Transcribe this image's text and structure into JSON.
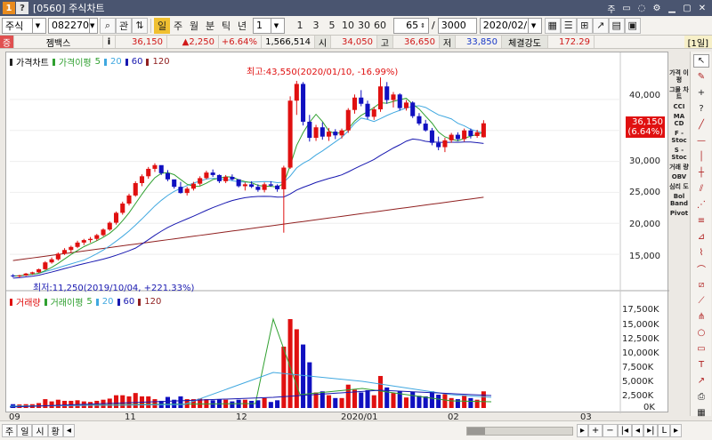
{
  "window": {
    "title": "[0560] 주식차트",
    "icon_a": "1",
    "icon_b": "?",
    "controls": [
      "주",
      "▭",
      "◌",
      "⚙",
      "▁",
      "▢",
      "✕"
    ]
  },
  "toolbar": {
    "market": "주식",
    "code": "082270",
    "search_label": "관",
    "periods": [
      "일",
      "주",
      "월",
      "분",
      "틱",
      "년"
    ],
    "interval_value": "1",
    "minute_presets": [
      "1",
      "3",
      "5",
      "10",
      "30",
      "60"
    ],
    "count": "65",
    "total": "3000",
    "date": "2020/02/13"
  },
  "info": {
    "name": "젬백스",
    "price": "36,150",
    "change": "▲2,250",
    "change_pct": "+6.64%",
    "volume": "1,566,514",
    "open_label": "시",
    "open": "34,050",
    "high_label": "고",
    "high": "36,650",
    "low_label": "저",
    "low": "33,850",
    "strength_label": "체결강도",
    "strength": "172.29",
    "period_badge": "[1일]"
  },
  "price_legend": {
    "main": "가격차트",
    "ma_label": "가격이평",
    "ma": [
      "5",
      "20",
      "60",
      "120"
    ]
  },
  "volume_legend": {
    "main": "거래량",
    "ma_label": "거래이평",
    "ma": [
      "5",
      "20",
      "60",
      "120"
    ]
  },
  "annotations": {
    "high": "최고:43,550(2020/01/10, -16.99%)",
    "low": "최저:11,250(2019/10/04, +221.33%)",
    "current_price": "36,150",
    "current_pct": "(6.64%)"
  },
  "price_axis": [
    "40,000",
    "35,000",
    "30,000",
    "25,000",
    "20,000",
    "15,000"
  ],
  "volume_axis": [
    "17,500K",
    "15,000K",
    "12,500K",
    "10,000K",
    "7,500K",
    "5,000K",
    "2,500K",
    "0K"
  ],
  "x_axis": [
    "09",
    "11",
    "12",
    "2020/01",
    "02",
    "03"
  ],
  "right_labels": [
    "가격 이평",
    "그물 차트",
    "CCI",
    "MA CD",
    "F - Stoc",
    "S - Stoc",
    "거래 량",
    "OBV",
    "심리 도",
    "Bol Band",
    "Pivot"
  ],
  "bottom_buttons": [
    "주",
    "일",
    "시",
    "황",
    "◂"
  ],
  "colors": {
    "up": "#e01010",
    "down": "#1010c0",
    "ma5": "#30a030",
    "ma20": "#40a8e0",
    "ma60": "#1818b0",
    "ma120": "#902020",
    "title_bar": "#4a5570"
  },
  "chart_data": {
    "type": "candlestick",
    "x_range": [
      "2019-09",
      "2020-03"
    ],
    "y_range": [
      10000,
      45000
    ],
    "candles_ohlc": [
      [
        11600,
        11800,
        11300,
        11500
      ],
      [
        11500,
        11700,
        11250,
        11600
      ],
      [
        11600,
        12000,
        11500,
        11900
      ],
      [
        11900,
        12200,
        11700,
        12100
      ],
      [
        12100,
        12700,
        12000,
        12600
      ],
      [
        12600,
        13900,
        12500,
        13700
      ],
      [
        13700,
        14500,
        13500,
        14200
      ],
      [
        14200,
        15300,
        14000,
        15100
      ],
      [
        15100,
        16000,
        14900,
        15700
      ],
      [
        15700,
        16400,
        15300,
        16200
      ],
      [
        16200,
        17200,
        16000,
        16900
      ],
      [
        16900,
        17500,
        16500,
        17300
      ],
      [
        17300,
        17800,
        16900,
        17500
      ],
      [
        17500,
        18300,
        17200,
        18100
      ],
      [
        18100,
        19200,
        17900,
        19000
      ],
      [
        19000,
        20300,
        18800,
        20100
      ],
      [
        20100,
        21900,
        19800,
        21700
      ],
      [
        21700,
        23500,
        21400,
        23200
      ],
      [
        23200,
        24800,
        22900,
        24500
      ],
      [
        24500,
        26800,
        24300,
        26500
      ],
      [
        26500,
        27900,
        26000,
        27600
      ],
      [
        27600,
        29100,
        27200,
        28800
      ],
      [
        28800,
        29700,
        28300,
        29400
      ],
      [
        29400,
        28900,
        27800,
        28100
      ],
      [
        28100,
        28600,
        26800,
        27100
      ],
      [
        27100,
        26900,
        25600,
        25900
      ],
      [
        25900,
        26700,
        24800,
        24900
      ],
      [
        24900,
        25900,
        24500,
        25600
      ],
      [
        25600,
        26700,
        25300,
        26400
      ],
      [
        26400,
        27600,
        26100,
        27300
      ],
      [
        27300,
        28500,
        27100,
        28200
      ],
      [
        28200,
        28700,
        27500,
        27800
      ],
      [
        27800,
        27900,
        26500,
        26800
      ],
      [
        26800,
        27800,
        26500,
        27500
      ],
      [
        27500,
        27900,
        26900,
        27100
      ],
      [
        27100,
        27100,
        25800,
        26000
      ],
      [
        26000,
        26600,
        25300,
        26300
      ],
      [
        26300,
        26800,
        25700,
        25900
      ],
      [
        25900,
        26300,
        25100,
        25400
      ],
      [
        25400,
        26600,
        25000,
        26300
      ],
      [
        26300,
        26800,
        25900,
        26100
      ],
      [
        26100,
        26300,
        25100,
        25500
      ],
      [
        25500,
        29300,
        18500,
        29000
      ],
      [
        29000,
        40500,
        28800,
        39800
      ],
      [
        39800,
        43000,
        37500,
        42500
      ],
      [
        42500,
        42800,
        35800,
        36400
      ],
      [
        36400,
        37500,
        33200,
        33800
      ],
      [
        33800,
        35900,
        33300,
        35500
      ],
      [
        35500,
        36300,
        33500,
        34000
      ],
      [
        34000,
        35400,
        33300,
        34800
      ],
      [
        34800,
        35200,
        33600,
        34200
      ],
      [
        34200,
        35300,
        33700,
        35000
      ],
      [
        35000,
        38600,
        34600,
        38300
      ],
      [
        38300,
        40800,
        37700,
        40300
      ],
      [
        40300,
        41500,
        38900,
        39300
      ],
      [
        39300,
        39800,
        36800,
        37200
      ],
      [
        37200,
        38800,
        36700,
        38400
      ],
      [
        38400,
        43550,
        38000,
        42100
      ],
      [
        42100,
        42800,
        39300,
        39900
      ],
      [
        39900,
        41200,
        38700,
        40800
      ],
      [
        40800,
        41000,
        38200,
        38600
      ],
      [
        38600,
        39900,
        38200,
        39500
      ],
      [
        39500,
        39700,
        37000,
        37300
      ],
      [
        37300,
        37800,
        35800,
        36100
      ],
      [
        36100,
        36700,
        34800,
        35000
      ],
      [
        35000,
        35400,
        32600,
        33000
      ],
      [
        33000,
        34000,
        31800,
        32300
      ],
      [
        32300,
        33800,
        31500,
        33400
      ],
      [
        33400,
        34600,
        33000,
        34300
      ],
      [
        34300,
        34700,
        33300,
        33600
      ],
      [
        33600,
        35300,
        33200,
        35000
      ],
      [
        35000,
        35300,
        33700,
        34100
      ],
      [
        34100,
        35100,
        33800,
        34700
      ],
      [
        33900,
        36650,
        33850,
        36150
      ]
    ]
  }
}
